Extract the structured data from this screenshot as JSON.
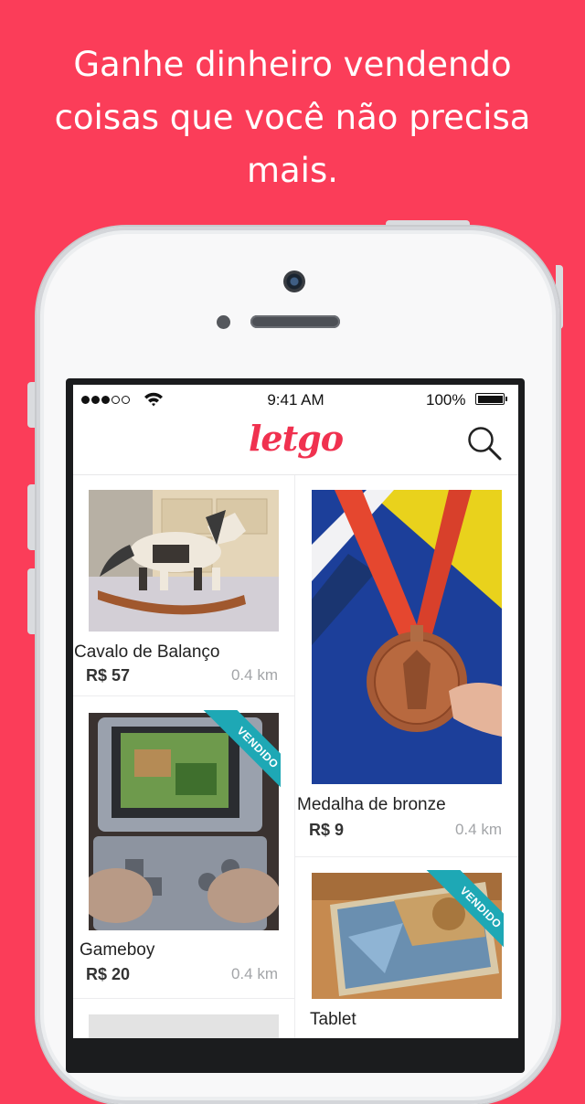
{
  "headline": {
    "line1": "Ganhe dinheiro vendendo",
    "line2": "coisas que você não precisa",
    "line3": "mais."
  },
  "status_bar": {
    "time": "9:41 AM",
    "battery": "100%",
    "signal_dots_filled": 3,
    "signal_dots_total": 5
  },
  "app": {
    "logo": "letgo"
  },
  "colors": {
    "background": "#fb3d59",
    "brand": "#f0314f",
    "sold_ribbon": "#1ea8b5"
  },
  "listings": [
    {
      "title": "Cavalo de Balanço",
      "price": "R$ 57",
      "distance": "0.4 km",
      "sold": false
    },
    {
      "title": "Medalha de bronze",
      "price": "R$ 9",
      "distance": "0.4 km",
      "sold": false
    },
    {
      "title": "Gameboy",
      "price": "R$ 20",
      "distance": "0.4 km",
      "sold": true,
      "badge": "VENDIDO"
    },
    {
      "title": "Tablet",
      "price": "",
      "distance": "",
      "sold": true,
      "badge": "VENDIDO"
    }
  ]
}
